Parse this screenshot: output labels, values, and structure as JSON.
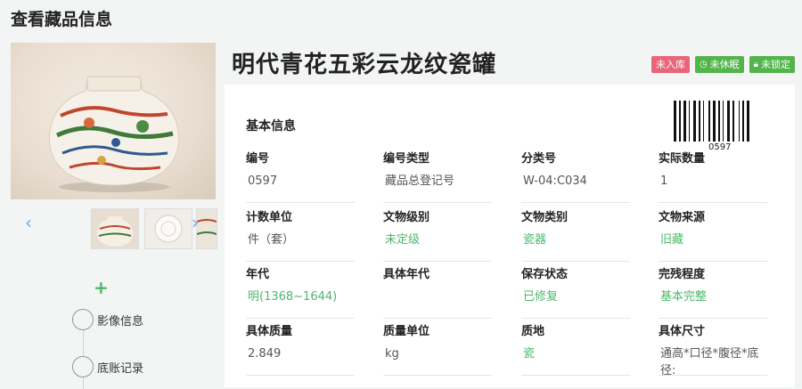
{
  "page": {
    "title": "查看藏品信息"
  },
  "object": {
    "title": "明代青花五彩云龙纹瓷罐"
  },
  "badges": [
    {
      "label": "未入库",
      "color": "#e9657a",
      "icon": ""
    },
    {
      "label": "未休眠",
      "color": "#52b44b",
      "icon": "clock-icon"
    },
    {
      "label": "未锁定",
      "color": "#52b44b",
      "icon": "lock-icon"
    }
  ],
  "gallery": {
    "prev_icon": "chevron-left-icon",
    "next_icon": "chevron-right-icon"
  },
  "timeline": {
    "add_icon": "plus-icon",
    "items": [
      {
        "label": "影像信息"
      },
      {
        "label": "底账记录"
      }
    ]
  },
  "basic_info": {
    "title": "基本信息",
    "barcode_number": "0597",
    "fields": [
      {
        "label": "编号",
        "value": "0597",
        "accent": false
      },
      {
        "label": "编号类型",
        "value": "藏品总登记号",
        "accent": false
      },
      {
        "label": "分类号",
        "value": "W-04:C034",
        "accent": false
      },
      {
        "label": "实际数量",
        "value": "1",
        "accent": false
      },
      {
        "label": "计数单位",
        "value": "件（套）",
        "accent": false
      },
      {
        "label": "文物级别",
        "value": "未定级",
        "accent": true
      },
      {
        "label": "文物类别",
        "value": "瓷器",
        "accent": true
      },
      {
        "label": "文物来源",
        "value": "旧藏",
        "accent": true
      },
      {
        "label": "年代",
        "value": "明(1368~1644)",
        "accent": true
      },
      {
        "label": "具体年代",
        "value": "",
        "accent": false
      },
      {
        "label": "保存状态",
        "value": "已修复",
        "accent": true
      },
      {
        "label": "完残程度",
        "value": "基本完整",
        "accent": true
      },
      {
        "label": "具体质量",
        "value": "2.849",
        "accent": false
      },
      {
        "label": "质量单位",
        "value": "kg",
        "accent": false
      },
      {
        "label": "质地",
        "value": "瓷",
        "accent": true
      },
      {
        "label": "具体尺寸",
        "value": "通高*口径*腹径*底径:",
        "accent": false
      }
    ]
  },
  "colors": {
    "accent_green": "#4cb86a",
    "badge_red": "#e9657a",
    "badge_green": "#52b44b",
    "arrow_blue": "#6ea9e6"
  }
}
